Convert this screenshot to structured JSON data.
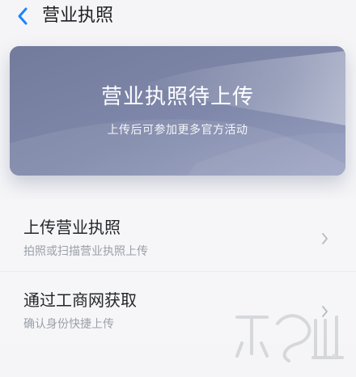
{
  "header": {
    "title": "营业执照",
    "back_icon": "chevron-left-icon"
  },
  "hero": {
    "title": "营业执照待上传",
    "subtitle": "上传后可参加更多官方活动"
  },
  "options": [
    {
      "label": "上传营业执照",
      "description": "拍照或扫描营业执照上传",
      "icon": "chevron-right-icon"
    },
    {
      "label": "通过工商网获取",
      "description": "确认身份快捷上传",
      "icon": "chevron-right-icon"
    }
  ],
  "colors": {
    "accent": "#1b84ff",
    "hero_background": "#7a83a6",
    "page_background": "#f5f5f7",
    "chevron": "#b7bcc4"
  }
}
